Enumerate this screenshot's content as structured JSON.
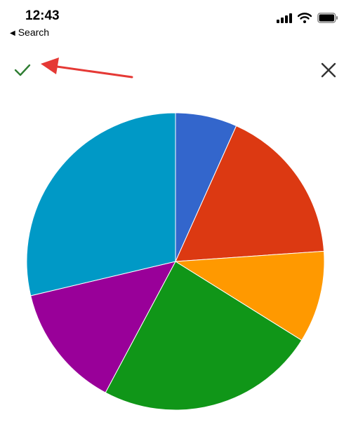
{
  "status_bar": {
    "time": "12:43",
    "back_label": "Search",
    "icons": [
      "signal-icon",
      "wifi-icon",
      "battery-icon"
    ]
  },
  "toolbar": {
    "confirm_icon": "checkmark-icon",
    "close_icon": "close-icon",
    "confirm_color": "#2e7d32",
    "annotation_color": "#e53935"
  },
  "chart_data": {
    "type": "pie",
    "values": [
      6.7,
      17.2,
      10.0,
      23.9,
      13.5,
      28.7
    ],
    "colors": [
      "#3366cc",
      "#dc3912",
      "#ff9900",
      "#109618",
      "#990099",
      "#0099c6"
    ],
    "title": "",
    "legend": "none"
  }
}
